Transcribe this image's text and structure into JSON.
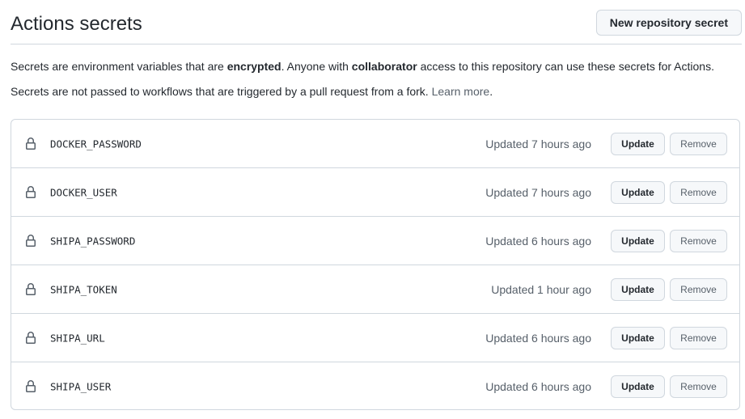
{
  "header": {
    "title": "Actions secrets",
    "new_secret_label": "New repository secret"
  },
  "description": {
    "line1_part1": "Secrets are environment variables that are ",
    "line1_bold1": "encrypted",
    "line1_part2": ". Anyone with ",
    "line1_bold2": "collaborator",
    "line1_part3": " access to this repository can use these secrets for Actions.",
    "line2_text": "Secrets are not passed to workflows that are triggered by a pull request from a fork. ",
    "line2_link": "Learn more",
    "line2_end": "."
  },
  "secrets": [
    {
      "name": "DOCKER_PASSWORD",
      "updated": "Updated 7 hours ago",
      "update_label": "Update",
      "remove_label": "Remove"
    },
    {
      "name": "DOCKER_USER",
      "updated": "Updated 7 hours ago",
      "update_label": "Update",
      "remove_label": "Remove"
    },
    {
      "name": "SHIPA_PASSWORD",
      "updated": "Updated 6 hours ago",
      "update_label": "Update",
      "remove_label": "Remove"
    },
    {
      "name": "SHIPA_TOKEN",
      "updated": "Updated 1 hour ago",
      "update_label": "Update",
      "remove_label": "Remove"
    },
    {
      "name": "SHIPA_URL",
      "updated": "Updated 6 hours ago",
      "update_label": "Update",
      "remove_label": "Remove"
    },
    {
      "name": "SHIPA_USER",
      "updated": "Updated 6 hours ago",
      "update_label": "Update",
      "remove_label": "Remove"
    }
  ],
  "icons": {
    "secret_row": "lock-icon"
  },
  "colors": {
    "border": "#d0d7de",
    "button_bg": "#f6f8fa",
    "text": "#24292f",
    "muted": "#57606a"
  }
}
